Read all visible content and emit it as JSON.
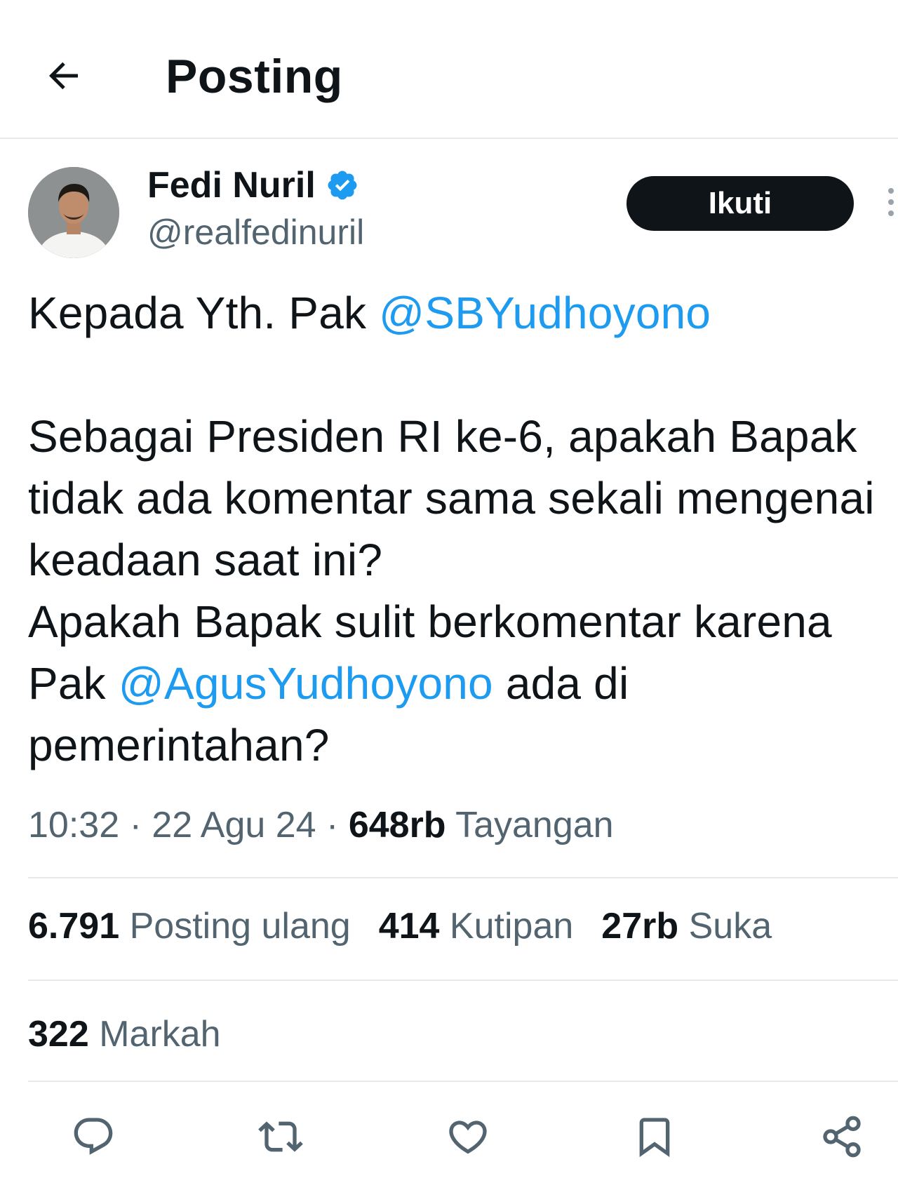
{
  "header": {
    "title": "Posting",
    "back_icon": "arrow-left-icon"
  },
  "author": {
    "name": "Fedi Nuril",
    "handle": "@realfedinuril",
    "verified_icon": "verified-badge-icon",
    "verified_color": "#1d9bf0"
  },
  "follow": {
    "label": "Ikuti"
  },
  "post": {
    "line1_text": "Kepada Yth. Pak ",
    "line1_mention": "@SBYudhoyono",
    "para2_part1": "Sebagai Presiden RI ke-6, apakah Bapak tidak ada komentar sama sekali mengenai keadaan saat ini?",
    "para2_part2": "Apakah Bapak sulit berkomentar karena Pak ",
    "para2_mention": "@AgusYudhoyono",
    "para2_part3": " ada di pemerintahan?"
  },
  "meta": {
    "time": "10:32",
    "sep": " · ",
    "date": "22 Agu 24",
    "views_count": "648rb",
    "views_label": " Tayangan"
  },
  "stats": {
    "reposts_count": "6.791",
    "reposts_label": " Posting ulang",
    "quotes_count": "414",
    "quotes_label": " Kutipan",
    "likes_count": "27rb",
    "likes_label": " Suka",
    "bookmarks_count": "322",
    "bookmarks_label": " Markah"
  },
  "actions": [
    "reply-icon",
    "repost-icon",
    "like-icon",
    "bookmark-icon",
    "share-icon"
  ],
  "colors": {
    "accent": "#1d9bf0",
    "text": "#0f1419",
    "muted": "#536471",
    "divider": "#e7e9ea"
  }
}
